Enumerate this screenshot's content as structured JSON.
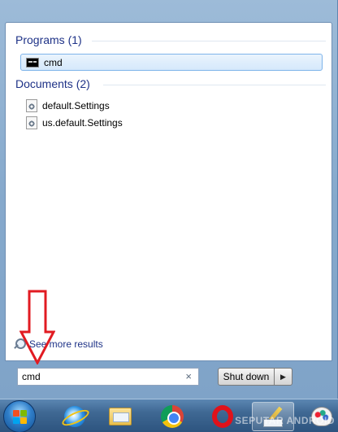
{
  "start_menu": {
    "sections": {
      "programs": {
        "header": "Programs (1)",
        "items": [
          {
            "label": "cmd",
            "icon": "cmd-icon",
            "selected": true
          }
        ]
      },
      "documents": {
        "header": "Documents (2)",
        "items": [
          {
            "label": "default.Settings",
            "icon": "settings-file-icon"
          },
          {
            "label": "us.default.Settings",
            "icon": "settings-file-icon"
          }
        ]
      }
    },
    "see_more": {
      "label": "See more results",
      "icon": "magnifier-icon"
    },
    "search": {
      "value": "cmd",
      "clear_icon": "×",
      "clear_icon_name": "clear-icon"
    },
    "shutdown": {
      "label": "Shut down",
      "arrow": "▶"
    }
  },
  "taskbar": {
    "items": [
      {
        "name": "start-button",
        "icon": "windows-orb-icon"
      },
      {
        "name": "internet-explorer",
        "icon": "internet-explorer-icon"
      },
      {
        "name": "windows-explorer",
        "icon": "folder-icon"
      },
      {
        "name": "google-chrome",
        "icon": "chrome-icon"
      },
      {
        "name": "opera",
        "icon": "opera-icon"
      },
      {
        "name": "pen-tool",
        "icon": "pen-icon",
        "active": true
      },
      {
        "name": "paint",
        "icon": "paint-icon"
      }
    ]
  },
  "watermark": {
    "text": "SEPUTAR ANDROID"
  },
  "colors": {
    "header_text": "#1e3287",
    "annotation_arrow": "#e11b22",
    "selection_border": "#7eb4ea"
  }
}
